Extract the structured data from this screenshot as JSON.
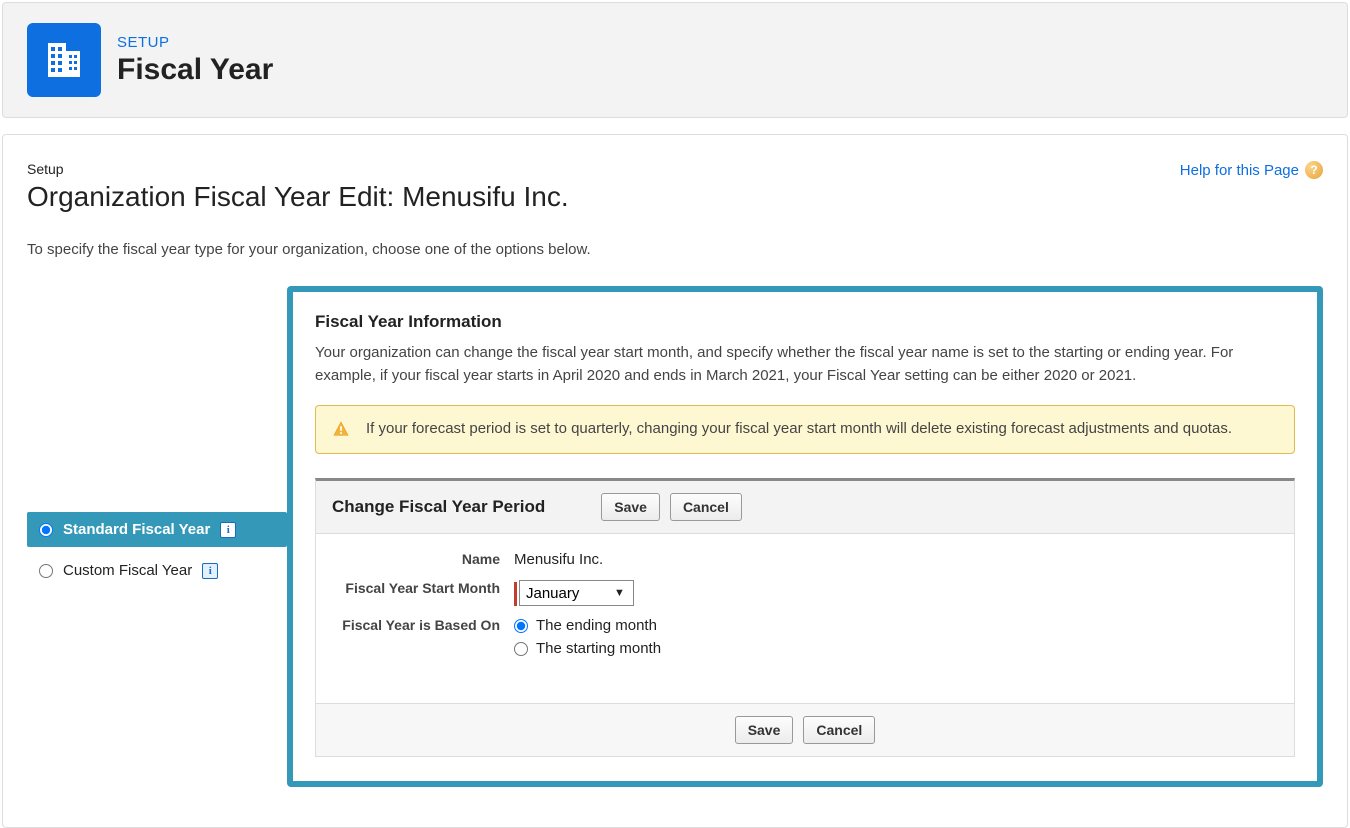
{
  "banner": {
    "eyebrow": "SETUP",
    "title": "Fiscal Year"
  },
  "header": {
    "crumb": "Setup",
    "title": "Organization Fiscal Year Edit: Menusifu Inc.",
    "helpLabel": "Help for this Page"
  },
  "intro": "To specify the fiscal year type for your organization, choose one of the options below.",
  "sidebar": {
    "standard": "Standard Fiscal Year",
    "custom": "Custom Fiscal Year"
  },
  "panel": {
    "title": "Fiscal Year Information",
    "desc": "Your organization can change the fiscal year start month, and specify whether the fiscal year name is set to the starting or ending year. For example, if your fiscal year starts in April 2020 and ends in March 2021, your Fiscal Year setting can be either 2020 or 2021.",
    "warning": "If your forecast period is set to quarterly, changing your fiscal year start month will delete existing forecast adjustments and quotas."
  },
  "form": {
    "sectionTitle": "Change Fiscal Year Period",
    "saveLabel": "Save",
    "cancelLabel": "Cancel",
    "nameLabel": "Name",
    "nameValue": "Menusifu Inc.",
    "startMonthLabel": "Fiscal Year Start Month",
    "startMonthValue": "January",
    "basedOnLabel": "Fiscal Year is Based On",
    "endingOption": "The ending month",
    "startingOption": "The starting month"
  }
}
